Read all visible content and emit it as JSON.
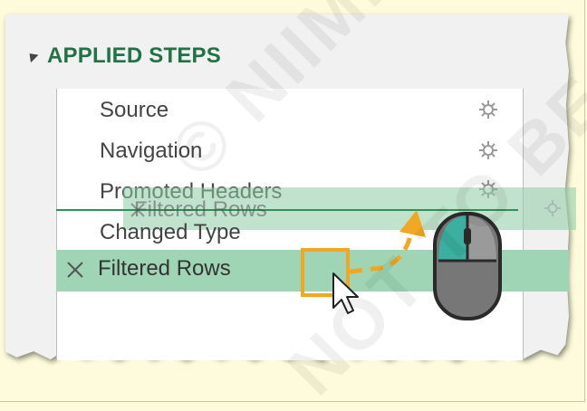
{
  "panel": {
    "title": "APPLIED STEPS",
    "collapse_icon": "triangle-collapse-icon"
  },
  "steps": [
    {
      "label": "Source",
      "icon": "gear-icon"
    },
    {
      "label": "Navigation",
      "icon": "gear-icon"
    },
    {
      "label": "Promoted Headers",
      "icon": "gear-icon"
    },
    {
      "label": "Changed Type",
      "icon": "none"
    },
    {
      "label": "Filtered Rows",
      "icon": "delete-x-icon",
      "selected": true
    }
  ],
  "drag_ghost": {
    "label": "Filtered Rows"
  },
  "watermark": {
    "line1": "© NIIMI",
    "line2": "NOT TO BE"
  },
  "colors": {
    "title": "#217346",
    "selected_row": "#9fd5b4",
    "drag_ghost": "#8eccA6",
    "drag_arrow": "#f0a823",
    "mouse_button": "#3bb0a0",
    "background": "#fdfbdc"
  }
}
